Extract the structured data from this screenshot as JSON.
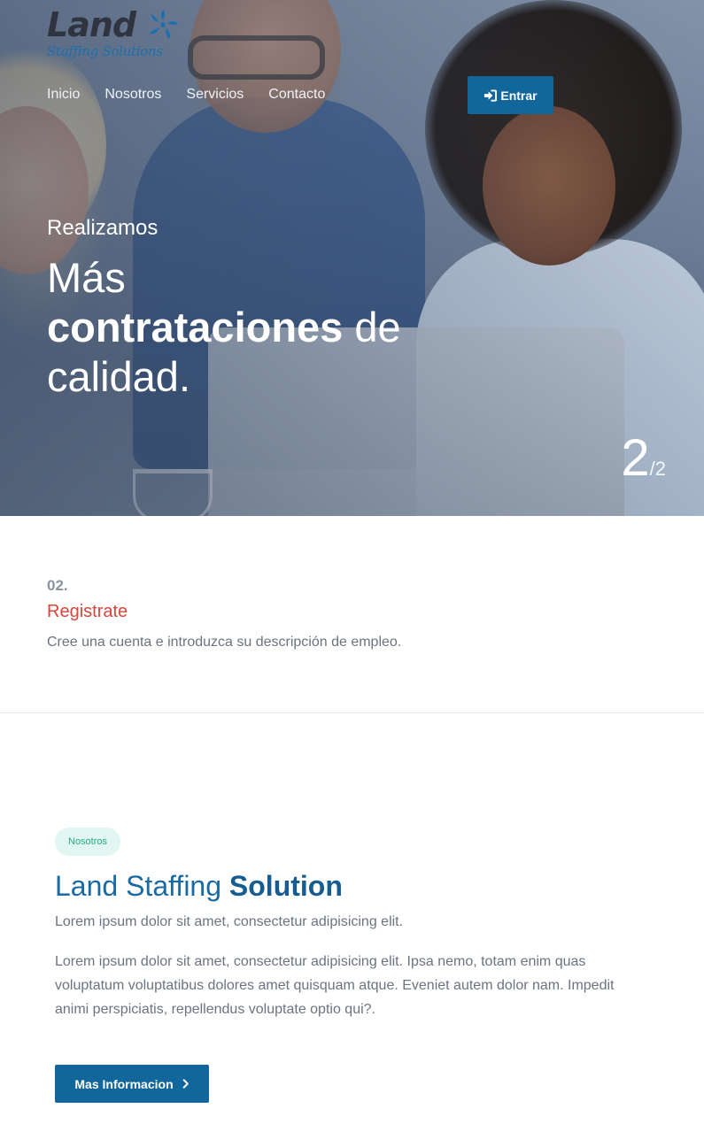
{
  "brand": {
    "logo_word": "Land",
    "logo_sub": "Staffing Solutions",
    "primary_color": "#11679c",
    "accent_red": "#d9453a",
    "accent_teal": "#26a889"
  },
  "nav": {
    "items": [
      "Inicio",
      "Nosotros",
      "Servicios",
      "Contacto"
    ],
    "login_label": "Entrar",
    "login_icon": "sign-in-icon"
  },
  "hero": {
    "eyebrow": "Realizamos",
    "title_line1": "Más",
    "title_bold": "contrataciones",
    "title_rest": " de",
    "title_line3": "calidad.",
    "slide_current": "2",
    "slide_total": "/2"
  },
  "step": {
    "number": "02.",
    "title": "Registrate",
    "description": "Cree una cuenta e introduzca su descripción de empleo."
  },
  "about": {
    "badge": "Nosotros",
    "title_regular": "Land Staffing ",
    "title_bold": "Solution",
    "lead": "Lorem ipsum dolor sit amet, consectetur adipisicing elit.",
    "body": "Lorem ipsum dolor sit amet, consectetur adipisicing elit. Ipsa nemo, totam enim quas voluptatum voluptatibus dolores amet quisquam atque. Eveniet autem dolor nam. Impedit animi perspiciatis, repellendus voluptate optio qui?.",
    "button_label": "Mas Informacion",
    "button_icon": "chevron-right-icon"
  }
}
